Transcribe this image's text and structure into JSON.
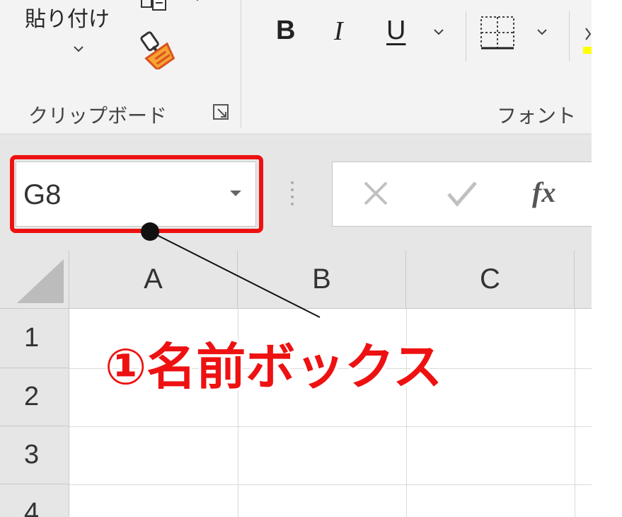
{
  "ribbon": {
    "clipboard": {
      "paste_label": "貼り付け",
      "group_label": "クリップボード"
    },
    "font": {
      "bold_label": "B",
      "italic_label": "I",
      "underline_label": "U",
      "group_label": "フォント"
    }
  },
  "formula_bar": {
    "name_box_value": "G8",
    "fx_label": "fx"
  },
  "grid": {
    "columns": [
      "A",
      "B",
      "C"
    ],
    "rows": [
      "1",
      "2",
      "3",
      "4"
    ]
  },
  "annotation": {
    "callout_text": "①名前ボックス",
    "color": "#ee1111"
  }
}
